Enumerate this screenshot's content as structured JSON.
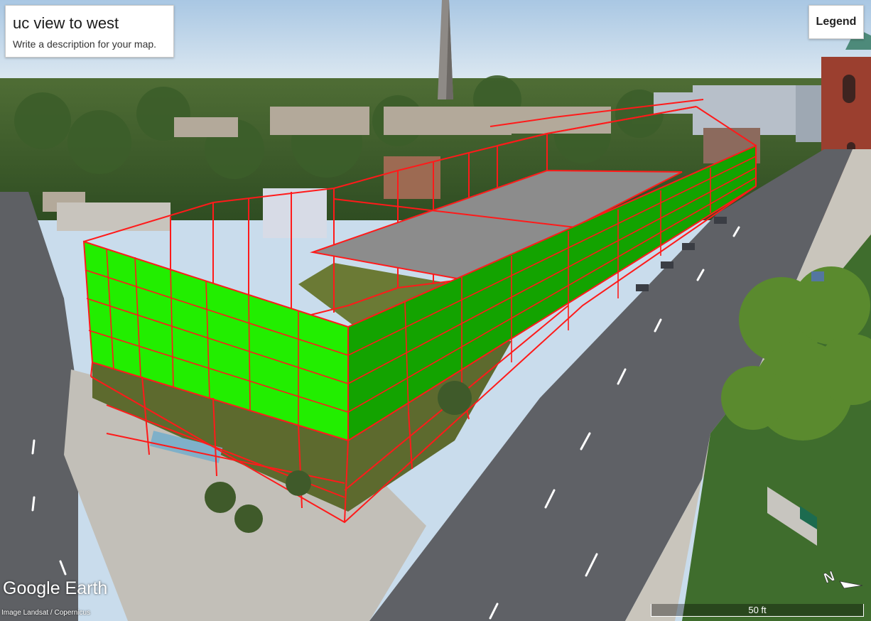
{
  "map": {
    "title": "uc view to west",
    "description": "Write a description for your map.",
    "legend_label": "Legend",
    "brand": "Google Earth",
    "attribution": "Image Landsat / Copernicus",
    "scale_label": "50 ft",
    "compass_icon": "north-arrow-icon",
    "colors": {
      "facade_green": "#22ee00",
      "facade_green_dark": "#13a300",
      "roof_gray": "#8c8c8c",
      "wireframe_red": "#ff1a1a",
      "sky": "#c9dcec"
    }
  }
}
